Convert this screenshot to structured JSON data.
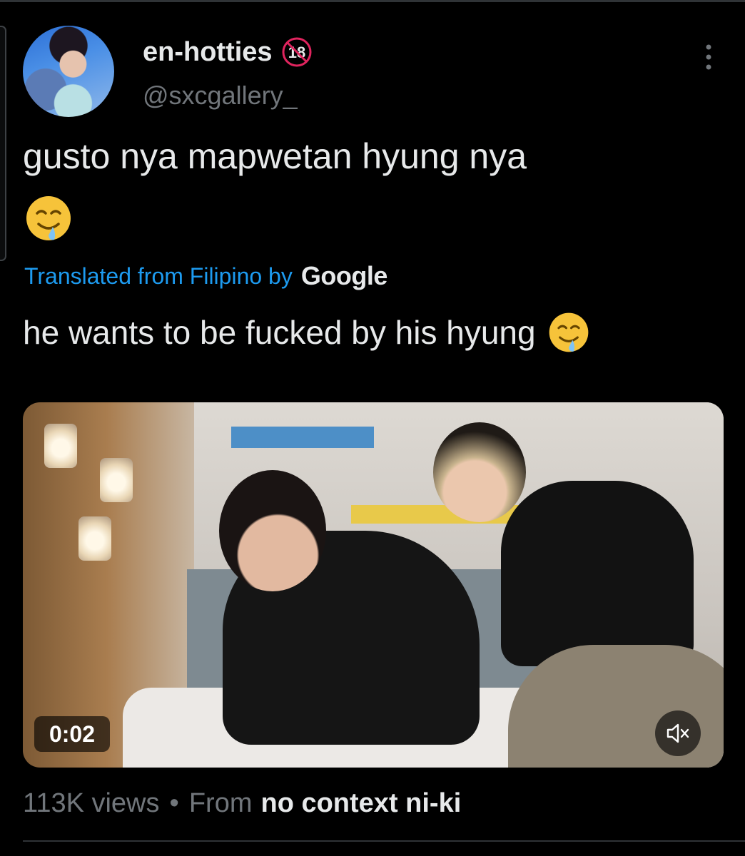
{
  "author": {
    "display_name": "en-hotties",
    "badge": "18",
    "handle": "@sxcgallery_"
  },
  "tweet": {
    "text": "gusto nya mapwetan hyung nya",
    "emoji": "drooling-face"
  },
  "translation": {
    "label": "Translated from Filipino by",
    "provider": "Google",
    "text": "he wants to be fucked by his hyung"
  },
  "video": {
    "duration": "0:02",
    "muted": true
  },
  "meta": {
    "views": "113K views",
    "separator": "•",
    "from_label": "From",
    "source": "no context ni-ki"
  },
  "colors": {
    "background": "#000000",
    "text": "#e7e9ea",
    "secondary": "#71767b",
    "link": "#1d9bf0",
    "badge_red": "#e0245e"
  }
}
